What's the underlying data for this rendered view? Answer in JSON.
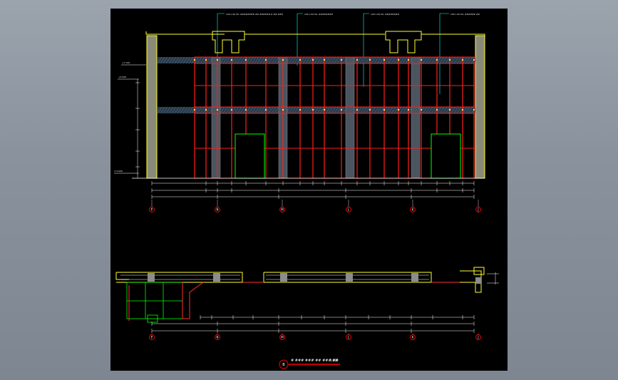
{
  "drawing": {
    "elevation_callouts": [
      "100 x 60 SS: ######## ## ###### # ## ###",
      "100 x 60 SS: ########",
      "100 x 60 SS: ########",
      "100 x 60 SS: ###### ##"
    ],
    "level_marks": [
      "+7.150",
      "+4.500",
      "± 0.000"
    ],
    "grid_axes": [
      "P",
      "N",
      "M",
      "L",
      "K",
      "J"
    ],
    "title_tag": "B",
    "title_text": "# ### ### ## ### ##",
    "scale_text": "1:100",
    "colors": {
      "background": "#000000",
      "mullion": "#ff1e1e",
      "outline": "#ffff33",
      "wall_fill": "#8a8a7a",
      "column": "#8c8c8c",
      "door": "#00ff00",
      "dimension": "#ffffff",
      "axis_bubble": "#ff0000",
      "leader": "#00ffff"
    }
  }
}
